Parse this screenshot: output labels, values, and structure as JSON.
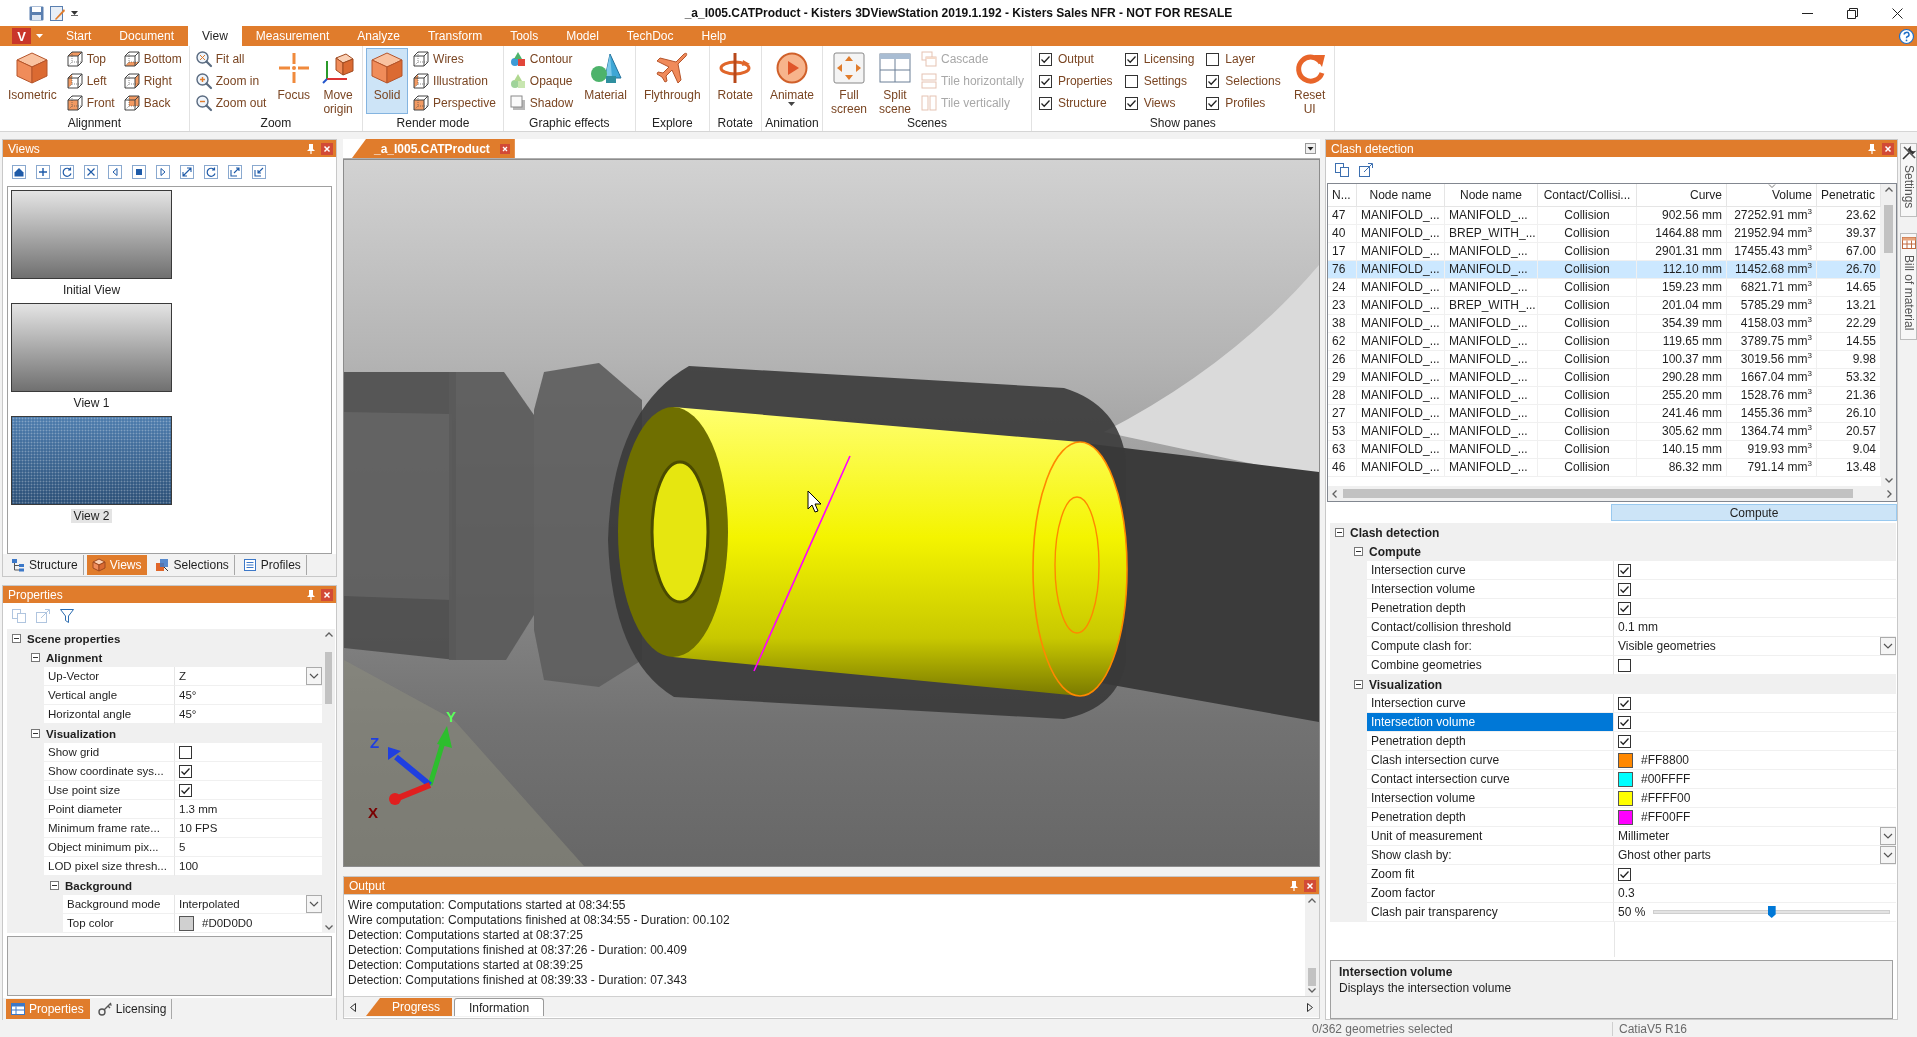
{
  "window": {
    "title": "_a_I005.CATProduct - Kisters 3DViewStation 2019.1.192 - Kisters Sales NFR - NOT FOR RESALE"
  },
  "ribbon": {
    "app_button": "V",
    "tabs": [
      {
        "label": "Start",
        "selected": false
      },
      {
        "label": "Document",
        "selected": false
      },
      {
        "label": "View",
        "selected": true
      },
      {
        "label": "Measurement",
        "selected": false
      },
      {
        "label": "Analyze",
        "selected": false
      },
      {
        "label": "Transform",
        "selected": false
      },
      {
        "label": "Tools",
        "selected": false
      },
      {
        "label": "Model",
        "selected": false
      },
      {
        "label": "TechDoc",
        "selected": false
      },
      {
        "label": "Help",
        "selected": false
      }
    ],
    "groups": [
      {
        "label": "Alignment",
        "items": [
          {
            "kind": "large",
            "label": "Isometric"
          },
          {
            "kind": "column",
            "items": [
              {
                "label": "Top"
              },
              {
                "label": "Left"
              },
              {
                "label": "Front"
              }
            ]
          },
          {
            "kind": "column",
            "items": [
              {
                "label": "Bottom"
              },
              {
                "label": "Right"
              },
              {
                "label": "Back"
              }
            ]
          }
        ]
      },
      {
        "label": "Zoom",
        "items": [
          {
            "kind": "column",
            "items": [
              {
                "label": "Fit all"
              },
              {
                "label": "Zoom in"
              },
              {
                "label": "Zoom out"
              }
            ]
          },
          {
            "kind": "large",
            "label": "Focus"
          },
          {
            "kind": "large",
            "label": "Move origin"
          }
        ]
      },
      {
        "label": "Render mode",
        "items": [
          {
            "kind": "large",
            "label": "Solid",
            "selected": true
          },
          {
            "kind": "column",
            "items": [
              {
                "label": "Wires"
              },
              {
                "label": "Illustration"
              },
              {
                "label": "Perspective"
              }
            ]
          }
        ]
      },
      {
        "label": "Graphic effects",
        "items": [
          {
            "kind": "column",
            "items": [
              {
                "label": "Contour"
              },
              {
                "label": "Opaque"
              },
              {
                "label": "Shadow"
              }
            ]
          },
          {
            "kind": "large",
            "label": "Material"
          }
        ]
      },
      {
        "label": "Explore",
        "items": [
          {
            "kind": "large",
            "label": "Flythrough"
          }
        ]
      },
      {
        "label": "Rotate",
        "items": [
          {
            "kind": "large",
            "label": "Rotate"
          }
        ]
      },
      {
        "label": "Animation",
        "items": [
          {
            "kind": "large",
            "label": "Animate",
            "dropdown": true
          }
        ]
      },
      {
        "label": "Scenes",
        "items": [
          {
            "kind": "large",
            "label": "Full screen"
          },
          {
            "kind": "large",
            "label": "Split scene"
          },
          {
            "kind": "column",
            "items": [
              {
                "label": "Cascade",
                "disabled": true
              },
              {
                "label": "Tile horizontally",
                "disabled": true
              },
              {
                "label": "Tile vertically",
                "disabled": true
              }
            ]
          }
        ]
      },
      {
        "label": "Show panes",
        "items": [
          {
            "kind": "checks",
            "items": [
              {
                "label": "Output",
                "checked": true
              },
              {
                "label": "Properties",
                "checked": true
              },
              {
                "label": "Structure",
                "checked": true
              }
            ]
          },
          {
            "kind": "checks",
            "items": [
              {
                "label": "Licensing",
                "checked": true
              },
              {
                "label": "Settings",
                "checked": false
              },
              {
                "label": "Views",
                "checked": true
              }
            ]
          },
          {
            "kind": "checks",
            "items": [
              {
                "label": "Layer",
                "checked": false
              },
              {
                "label": "Selections",
                "checked": true
              },
              {
                "label": "Profiles",
                "checked": true
              }
            ]
          },
          {
            "kind": "large",
            "label": "Reset UI"
          }
        ]
      }
    ]
  },
  "views_panel": {
    "title": "Views",
    "views": [
      {
        "label": "Initial View",
        "selected": false
      },
      {
        "label": "View 1",
        "selected": false
      },
      {
        "label": "View 2",
        "selected": true
      }
    ],
    "tabs": [
      {
        "label": "Structure",
        "selected": false
      },
      {
        "label": "Views",
        "selected": true
      },
      {
        "label": "Selections",
        "selected": false
      },
      {
        "label": "Profiles",
        "selected": false
      }
    ]
  },
  "properties_panel": {
    "title": "Properties",
    "tree": [
      {
        "kind": "group",
        "label": "Scene properties",
        "expanded": true,
        "children": [
          {
            "kind": "group",
            "label": "Alignment",
            "expanded": true,
            "children": [
              {
                "kind": "dropdown",
                "label": "Up-Vector",
                "value": "Z",
                "selected": false
              },
              {
                "kind": "text",
                "label": "Vertical angle",
                "value": "45°",
                "selected": false
              },
              {
                "kind": "text",
                "label": "Horizontal angle",
                "value": "45°",
                "selected": false
              }
            ]
          },
          {
            "kind": "group",
            "label": "Visualization",
            "expanded": true,
            "children": [
              {
                "kind": "check",
                "label": "Show grid",
                "checked": false,
                "selected": false
              },
              {
                "kind": "check",
                "label": "Show coordinate sys...",
                "checked": true,
                "selected": false
              },
              {
                "kind": "check",
                "label": "Use point size",
                "checked": true,
                "selected": false
              },
              {
                "kind": "text",
                "label": "Point diameter",
                "value": "1.3 mm",
                "selected": false
              },
              {
                "kind": "text",
                "label": "Minimum frame rate...",
                "value": "10 FPS",
                "selected": false
              },
              {
                "kind": "text",
                "label": "Object minimum pix...",
                "value": "5",
                "selected": false
              },
              {
                "kind": "text",
                "label": "LOD pixel size thresh...",
                "value": "100",
                "selected": false
              },
              {
                "kind": "group",
                "label": "Background",
                "expanded": true,
                "children": [
                  {
                    "kind": "dropdown",
                    "label": "Background mode",
                    "value": "Interpolated",
                    "selected": false
                  },
                  {
                    "kind": "color",
                    "label": "Top color",
                    "color": "#d0d0d0",
                    "value": "#D0D0D0",
                    "selected": false
                  }
                ]
              }
            ]
          }
        ]
      }
    ],
    "tabs": [
      {
        "label": "Properties",
        "selected": true
      },
      {
        "label": "Licensing",
        "selected": false
      }
    ]
  },
  "document": {
    "tabs": [
      {
        "label": "_a_I005.CATProduct",
        "selected": true
      }
    ]
  },
  "viewport": {
    "axes": {
      "x": "X",
      "y": "Y",
      "z": "Z"
    }
  },
  "output": {
    "title": "Output",
    "lines": [
      "Wire computation: Computations started at 08:34:55",
      "Wire computation: Computations finished at 08:34:55 - Duration: 00.102",
      "Detection: Computations started at 08:37:25",
      "Detection: Computations finished at 08:37:26 - Duration: 00.409",
      "Detection: Computations started at 08:39:25",
      "Detection: Computations finished at 08:39:33 - Duration: 07.343"
    ],
    "tabs": [
      {
        "label": "Progress",
        "selected": true
      },
      {
        "label": "Information",
        "selected": false
      }
    ]
  },
  "clash_panel": {
    "title": "Clash detection",
    "table": {
      "columns": [
        {
          "label": "N...",
          "sorted": false
        },
        {
          "label": "Node name",
          "sorted": false
        },
        {
          "label": "Node name",
          "sorted": false
        },
        {
          "label": "Contact/Collisi...",
          "sorted": false
        },
        {
          "label": "Curve",
          "sorted": false
        },
        {
          "label": "Volume",
          "sorted": true
        },
        {
          "label": "Penetratic",
          "sorted": false
        }
      ],
      "rows": [
        {
          "cells": [
            "47",
            "MANIFOLD_...",
            "MANIFOLD_...",
            "Collision",
            "902.56 mm",
            "27252.91 mm$^{3}$",
            "23.62"
          ],
          "selected": false
        },
        {
          "cells": [
            "40",
            "MANIFOLD_...",
            "BREP_WITH_...",
            "Collision",
            "1464.88 mm",
            "21952.94 mm$^{3}$",
            "39.37"
          ],
          "selected": false
        },
        {
          "cells": [
            "17",
            "MANIFOLD_...",
            "MANIFOLD_...",
            "Collision",
            "2901.31 mm",
            "17455.43 mm$^{3}$",
            "67.00"
          ],
          "selected": false
        },
        {
          "cells": [
            "76",
            "MANIFOLD_...",
            "MANIFOLD_...",
            "Collision",
            "112.10 mm",
            "11452.68 mm$^{3}$",
            "26.70"
          ],
          "selected": true
        },
        {
          "cells": [
            "24",
            "MANIFOLD_...",
            "MANIFOLD_...",
            "Collision",
            "159.23 mm",
            "6821.71 mm$^{3}$",
            "14.65"
          ],
          "selected": false
        },
        {
          "cells": [
            "23",
            "MANIFOLD_...",
            "BREP_WITH_...",
            "Collision",
            "201.04 mm",
            "5785.29 mm$^{3}$",
            "13.21"
          ],
          "selected": false
        },
        {
          "cells": [
            "38",
            "MANIFOLD_...",
            "MANIFOLD_...",
            "Collision",
            "354.39 mm",
            "4158.03 mm$^{3}$",
            "22.29"
          ],
          "selected": false
        },
        {
          "cells": [
            "62",
            "MANIFOLD_...",
            "MANIFOLD_...",
            "Collision",
            "119.65 mm",
            "3789.75 mm$^{3}$",
            "14.55"
          ],
          "selected": false
        },
        {
          "cells": [
            "26",
            "MANIFOLD_...",
            "MANIFOLD_...",
            "Collision",
            "100.37 mm",
            "3019.56 mm$^{3}$",
            "9.98"
          ],
          "selected": false
        },
        {
          "cells": [
            "29",
            "MANIFOLD_...",
            "MANIFOLD_...",
            "Collision",
            "290.28 mm",
            "1667.04 mm$^{3}$",
            "53.32"
          ],
          "selected": false
        },
        {
          "cells": [
            "28",
            "MANIFOLD_...",
            "MANIFOLD_...",
            "Collision",
            "255.20 mm",
            "1528.76 mm$^{3}$",
            "21.36"
          ],
          "selected": false
        },
        {
          "cells": [
            "27",
            "MANIFOLD_...",
            "MANIFOLD_...",
            "Collision",
            "241.46 mm",
            "1455.36 mm$^{3}$",
            "26.10"
          ],
          "selected": false
        },
        {
          "cells": [
            "53",
            "MANIFOLD_...",
            "MANIFOLD_...",
            "Collision",
            "305.62 mm",
            "1364.74 mm$^{3}$",
            "20.57"
          ],
          "selected": false
        },
        {
          "cells": [
            "63",
            "MANIFOLD_...",
            "MANIFOLD_...",
            "Collision",
            "140.15 mm",
            "919.93 mm$^{3}$",
            "9.04"
          ],
          "selected": false
        },
        {
          "cells": [
            "46",
            "MANIFOLD_...",
            "MANIFOLD_...",
            "Collision",
            "86.32 mm",
            "791.14 mm$^{3}$",
            "13.48"
          ],
          "selected": false
        }
      ]
    },
    "compute_button": "Compute",
    "tree": [
      {
        "kind": "group",
        "label": "Clash detection",
        "expanded": true,
        "children": [
          {
            "kind": "group",
            "label": "Compute",
            "expanded": true,
            "children": [
              {
                "kind": "check",
                "label": "Intersection curve",
                "checked": true,
                "selected": false
              },
              {
                "kind": "check",
                "label": "Intersection volume",
                "checked": true,
                "selected": false
              },
              {
                "kind": "check",
                "label": "Penetration depth",
                "checked": true,
                "selected": false
              },
              {
                "kind": "text",
                "label": "Contact/collision threshold",
                "value": "0.1 mm",
                "selected": false
              },
              {
                "kind": "dropdown",
                "label": "Compute clash for:",
                "value": "Visible geometries",
                "selected": false
              },
              {
                "kind": "check",
                "label": "Combine geometries",
                "checked": false,
                "selected": false
              }
            ]
          },
          {
            "kind": "group",
            "label": "Visualization",
            "expanded": true,
            "children": [
              {
                "kind": "check",
                "label": "Intersection curve",
                "checked": true,
                "selected": false
              },
              {
                "kind": "check",
                "label": "Intersection volume",
                "checked": true,
                "selected": true
              },
              {
                "kind": "check",
                "label": "Penetration depth",
                "checked": true,
                "selected": false
              },
              {
                "kind": "color",
                "label": "Clash intersection curve",
                "color": "#ff8800",
                "value": "#FF8800",
                "selected": false
              },
              {
                "kind": "color",
                "label": "Contact intersection curve",
                "color": "#00ffff",
                "value": "#00FFFF",
                "selected": false
              },
              {
                "kind": "color",
                "label": "Intersection volume",
                "color": "#ffff00",
                "value": "#FFFF00",
                "selected": false
              },
              {
                "kind": "color",
                "label": "Penetration depth",
                "color": "#ff00ff",
                "value": "#FF00FF",
                "selected": false
              },
              {
                "kind": "dropdown",
                "label": "Unit of measurement",
                "value": "Millimeter",
                "selected": false
              },
              {
                "kind": "dropdown",
                "label": "Show clash by:",
                "value": "Ghost other parts",
                "selected": false
              },
              {
                "kind": "check",
                "label": "Zoom fit",
                "checked": true,
                "selected": false
              },
              {
                "kind": "text",
                "label": "Zoom factor",
                "value": "0.3",
                "selected": false
              },
              {
                "kind": "slider",
                "label": "Clash pair transparency",
                "value": "50 %",
                "level": 0.5,
                "selected": false
              }
            ]
          }
        ]
      }
    ],
    "description": {
      "title": "Intersection volume",
      "text": "Displays the intersection volume"
    }
  },
  "side_tabs": [
    {
      "label": "Settings"
    },
    {
      "label": "Bill of material"
    }
  ],
  "status_bar": {
    "sections": [
      "0/362 geometries selected",
      "CatiaV5 R16"
    ]
  }
}
